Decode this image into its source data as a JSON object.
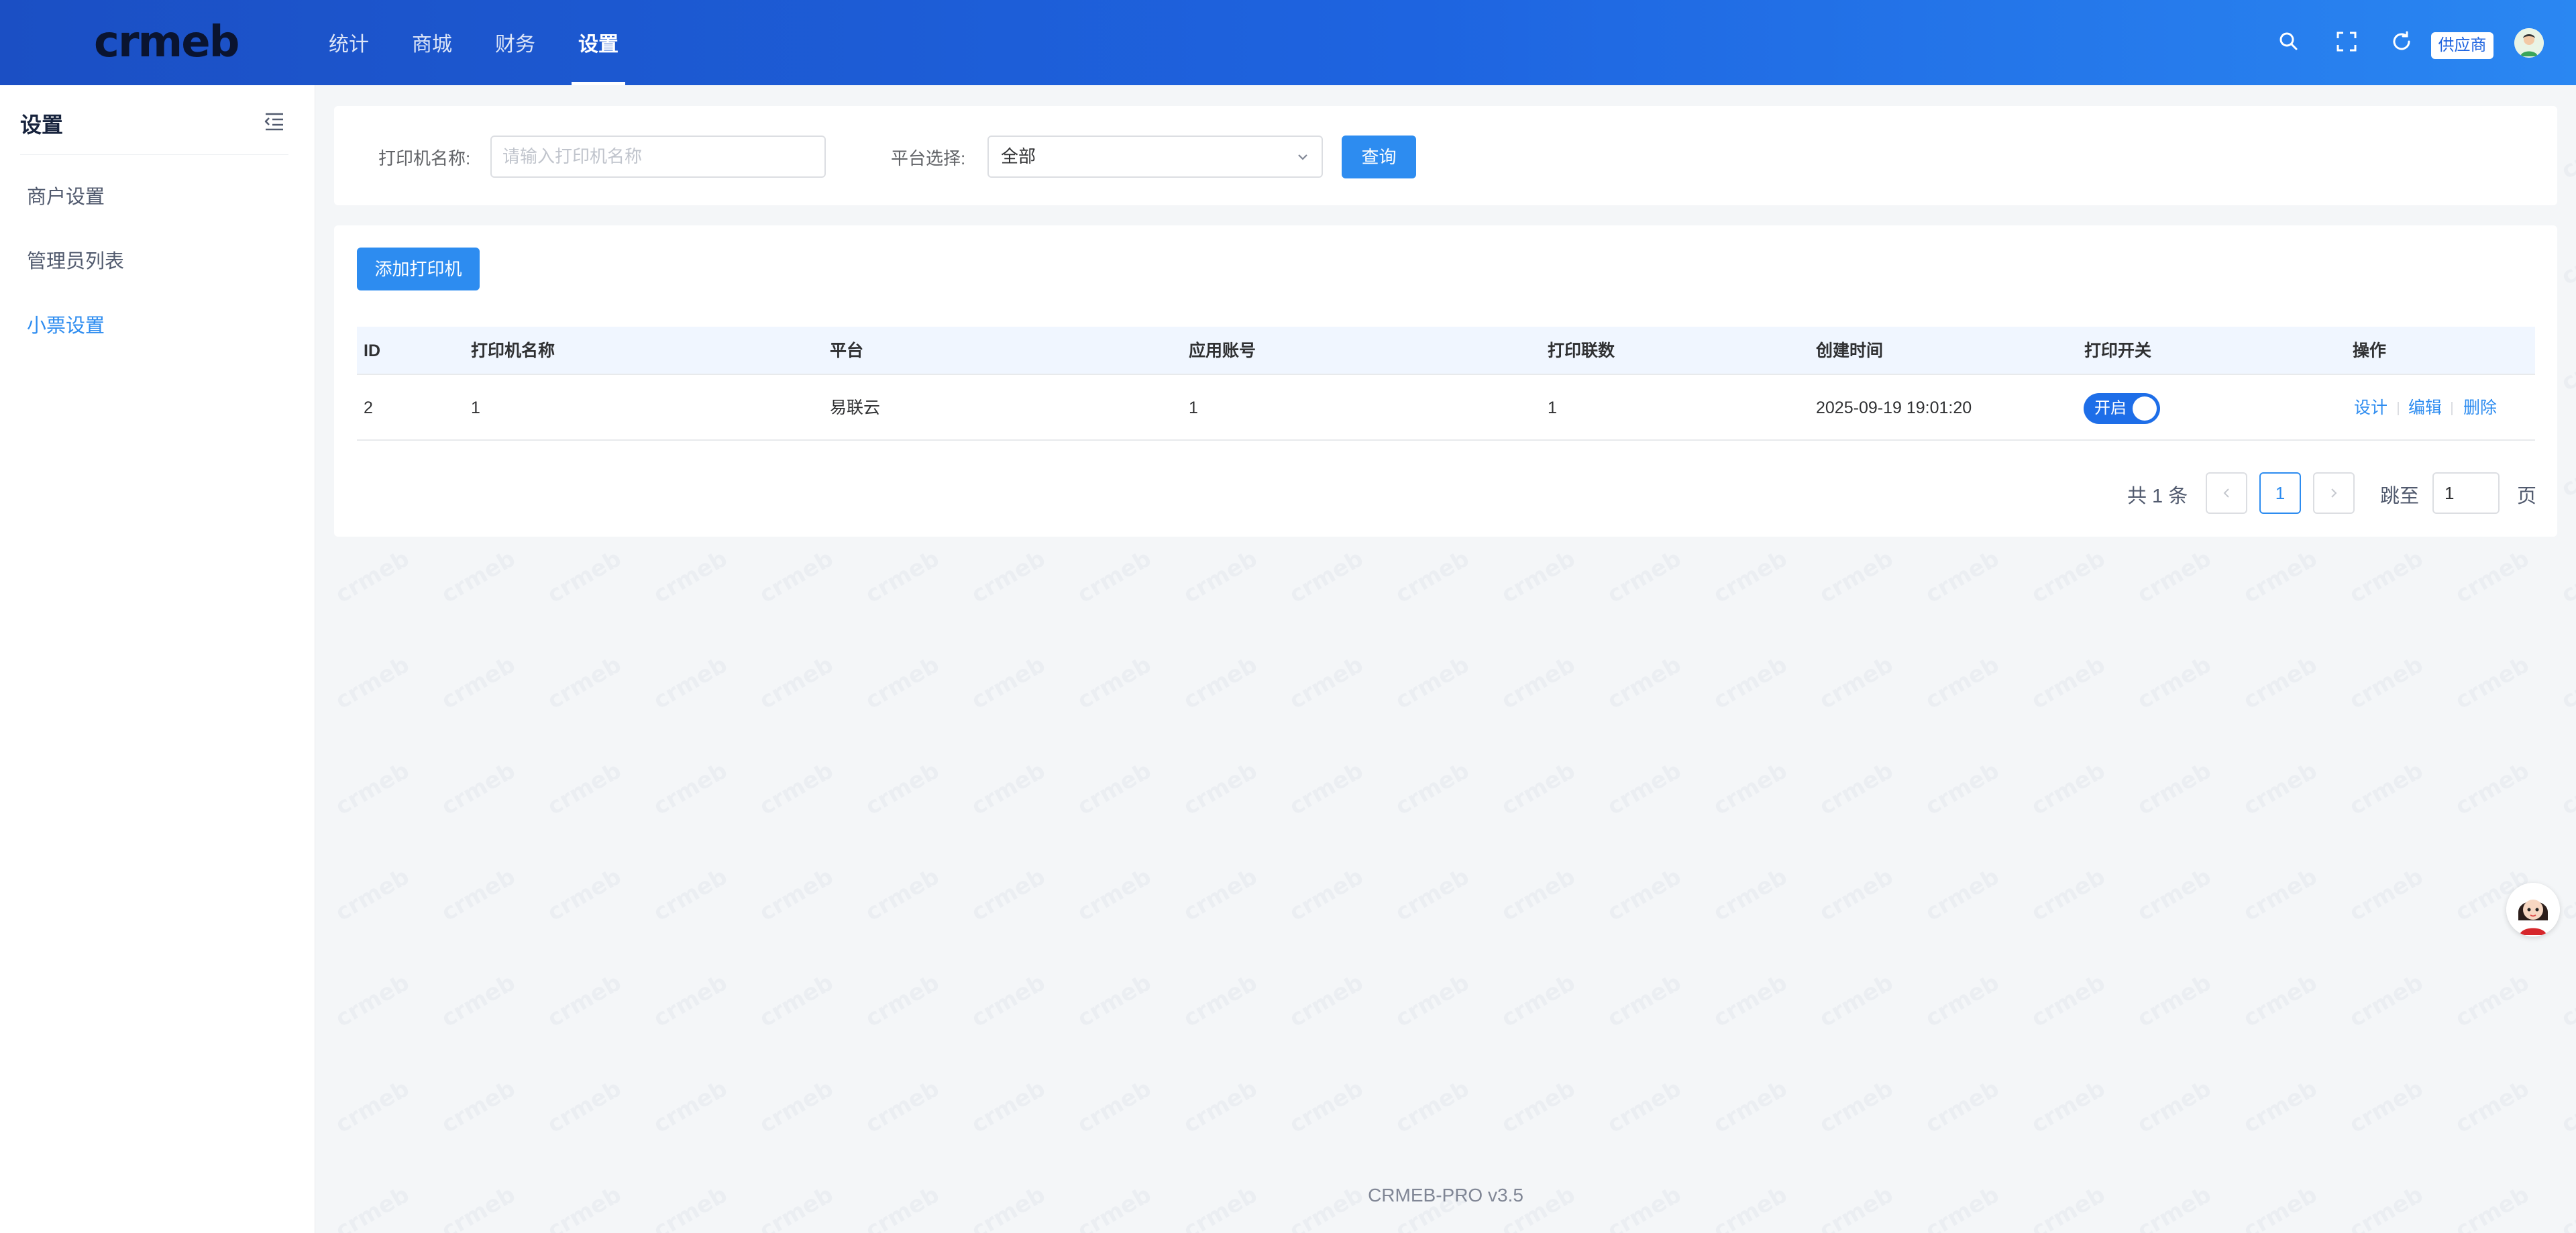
{
  "header": {
    "logo_text": "crmeb",
    "nav": [
      "统计",
      "商城",
      "财务",
      "设置"
    ],
    "active_nav": "设置",
    "role_badge": "供应商",
    "colors": {
      "gradient_start": "#1b4fc4",
      "gradient_end": "#2a87f2"
    }
  },
  "sidebar": {
    "title": "设置",
    "items": [
      "商户设置",
      "管理员列表",
      "小票设置"
    ],
    "active_item": "小票设置"
  },
  "filter": {
    "name_label": "打印机名称:",
    "name_placeholder": "请输入打印机名称",
    "platform_label": "平台选择:",
    "platform_value": "全部",
    "query_button": "查询"
  },
  "table": {
    "add_button": "添加打印机",
    "columns": [
      "ID",
      "打印机名称",
      "平台",
      "应用账号",
      "打印联数",
      "创建时间",
      "打印开关",
      "操作"
    ],
    "rows": [
      {
        "id": "2",
        "name": "1",
        "platform": "易联云",
        "account": "1",
        "copies": "1",
        "created": "2025-09-19 19:01:20",
        "switch_label": "开启",
        "switch_on": true,
        "actions": [
          "设计",
          "编辑",
          "删除"
        ]
      }
    ]
  },
  "pagination": {
    "total": "共 1 条",
    "current_page": "1",
    "jump_label": "跳至",
    "jump_value": "1",
    "page_suffix": "页"
  },
  "footer": "CRMEB-PRO v3.5",
  "accent_color": "#2d8cf0"
}
